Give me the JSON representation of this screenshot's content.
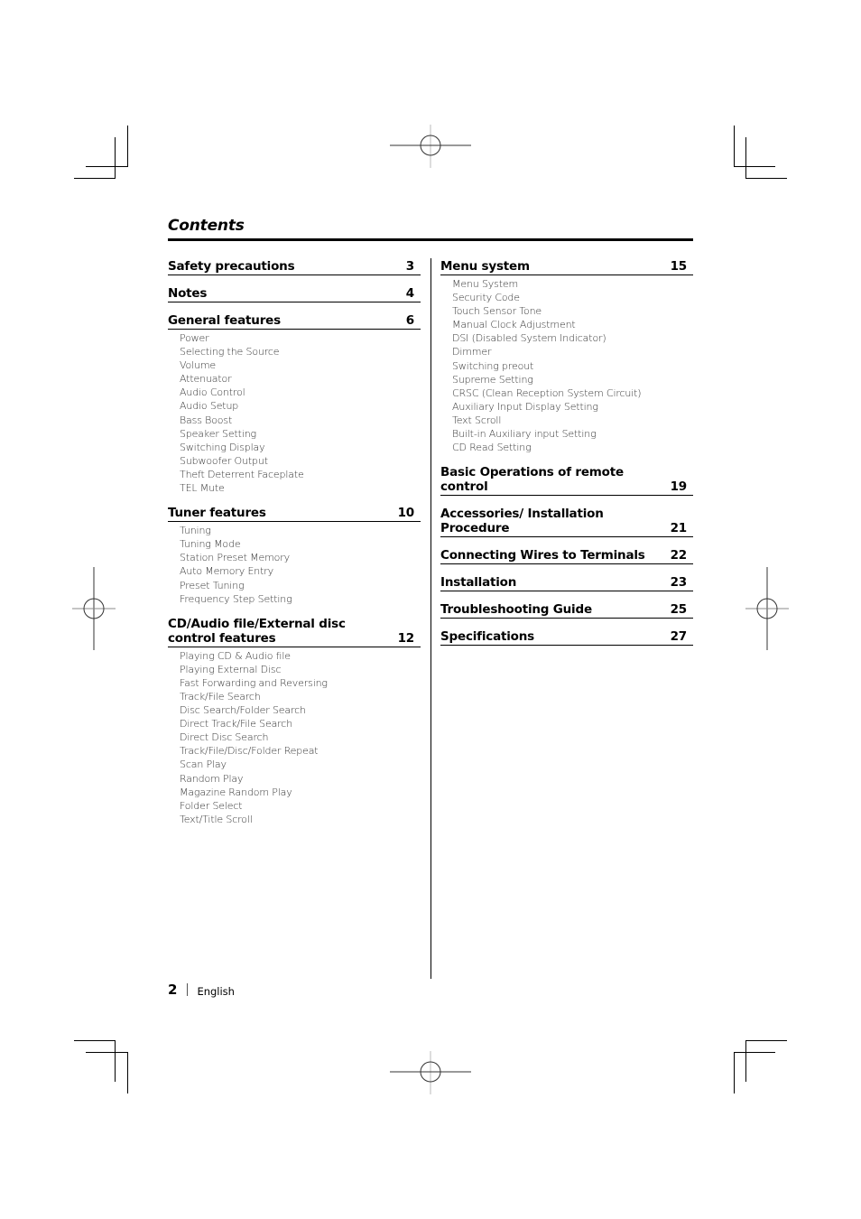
{
  "page": {
    "title": "Contents",
    "footer": {
      "page_number": "2",
      "language": "English"
    }
  },
  "left_column": [
    {
      "label": "Safety precautions",
      "page": "3",
      "items": []
    },
    {
      "label": "Notes",
      "page": "4",
      "items": []
    },
    {
      "label": "General features",
      "page": "6",
      "items": [
        "Power",
        "Selecting the Source",
        "Volume",
        "Attenuator",
        "Audio Control",
        "Audio Setup",
        "Bass Boost",
        "Speaker Setting",
        "Switching Display",
        "Subwoofer Output",
        "Theft Deterrent Faceplate",
        "TEL Mute"
      ]
    },
    {
      "label": "Tuner features",
      "page": "10",
      "items": [
        "Tuning",
        "Tuning Mode",
        "Station Preset Memory",
        "Auto Memory Entry",
        "Preset Tuning",
        "Frequency Step Setting"
      ]
    },
    {
      "label": "CD/Audio file/External disc control features",
      "page": "12",
      "items": [
        "Playing CD & Audio file",
        "Playing External Disc",
        "Fast Forwarding and Reversing",
        "Track/File Search",
        "Disc Search/Folder Search",
        "Direct Track/File Search",
        "Direct Disc Search",
        "Track/File/Disc/Folder Repeat",
        "Scan Play",
        "Random Play",
        "Magazine Random Play",
        "Folder Select",
        "Text/Title Scroll"
      ]
    }
  ],
  "right_column": [
    {
      "label": "Menu system",
      "page": "15",
      "items": [
        "Menu System",
        "Security Code",
        "Touch Sensor Tone",
        "Manual Clock Adjustment",
        "DSI (Disabled System Indicator)",
        "Dimmer",
        "Switching preout",
        "Supreme Setting",
        "CRSC (Clean Reception System Circuit)",
        "Auxiliary Input Display Setting",
        "Text Scroll",
        "Built-in Auxiliary input Setting",
        "CD Read Setting"
      ]
    },
    {
      "label": "Basic Operations of remote control",
      "page": "19",
      "items": []
    },
    {
      "label": "Accessories/ Installation Procedure",
      "page": "21",
      "items": []
    },
    {
      "label": "Connecting Wires to Terminals",
      "page": "22",
      "items": []
    },
    {
      "label": "Installation",
      "page": "23",
      "items": []
    },
    {
      "label": "Troubleshooting Guide",
      "page": "25",
      "items": []
    },
    {
      "label": "Specifications",
      "page": "27",
      "items": []
    }
  ]
}
